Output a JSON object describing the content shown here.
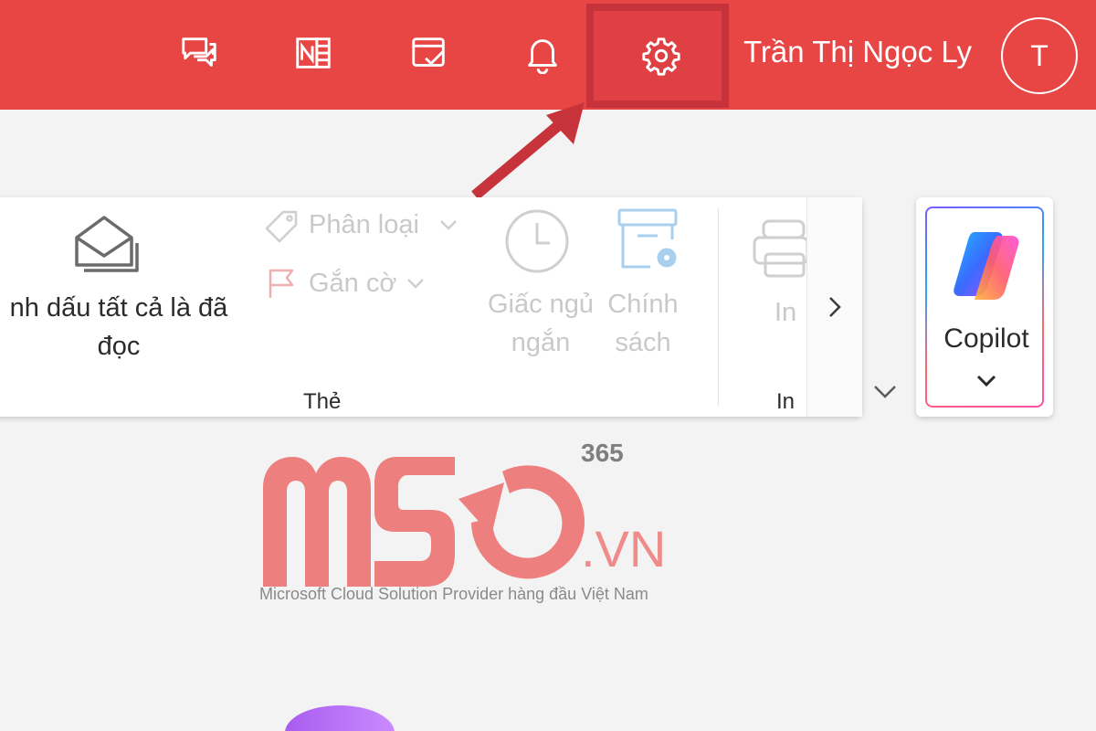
{
  "header": {
    "user_name": "Trần Thị Ngọc Ly",
    "avatar_initial": "T",
    "icons": [
      "chat-icon",
      "onenote-icon",
      "calendar-check-icon",
      "bell-icon",
      "gear-icon"
    ],
    "brand_color": "#e84545",
    "highlight_color": "#c6333a"
  },
  "ribbon": {
    "mark_all_read_label": "nh dấu tất cả là đã\nđọc",
    "categorize_label": "Phân loại",
    "flag_label": "Gắn cờ",
    "snooze_label": "Giấc ngủ\nngắn",
    "policy_label": "Chính\nsách",
    "print_label": "In",
    "group_tags": "Thẻ",
    "group_print": "In"
  },
  "copilot": {
    "label": "Copilot"
  },
  "watermark": {
    "brand_text": "MSO",
    "superscript": "365",
    "domain_suffix": ".VN",
    "tagline": "Microsoft Cloud Solution Provider hàng đầu Việt Nam"
  }
}
